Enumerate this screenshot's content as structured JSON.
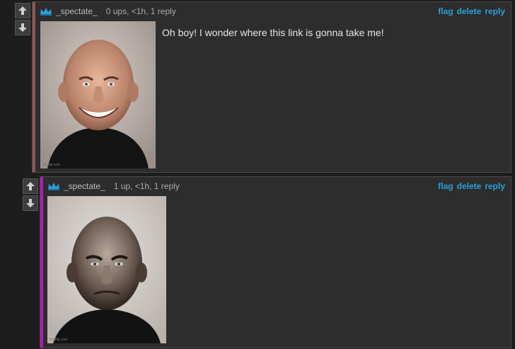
{
  "comments": [
    {
      "username": "_spectate_",
      "meta": "0 ups, <1h, 1 reply",
      "text": "Oh boy! I wonder where this link is gonna take me!",
      "bar_color": "#8f5457",
      "image_watermark": "imgflip.com",
      "actions": [
        "flag",
        "delete",
        "reply"
      ]
    },
    {
      "username": "_spectate_",
      "meta": "1 up, <1h, 1 reply",
      "text": "",
      "bar_color": "#b51ab5",
      "image_watermark": "imgflip.com",
      "actions": [
        "flag",
        "delete",
        "reply"
      ]
    }
  ],
  "icons": [
    "upvote-arrow-icon",
    "downvote-arrow-icon",
    "crown-icon"
  ],
  "colors": {
    "link": "#2a9fd6",
    "crown": "#2a9fd6",
    "background": "#1d1d1d",
    "panel": "#2d2d2d"
  }
}
